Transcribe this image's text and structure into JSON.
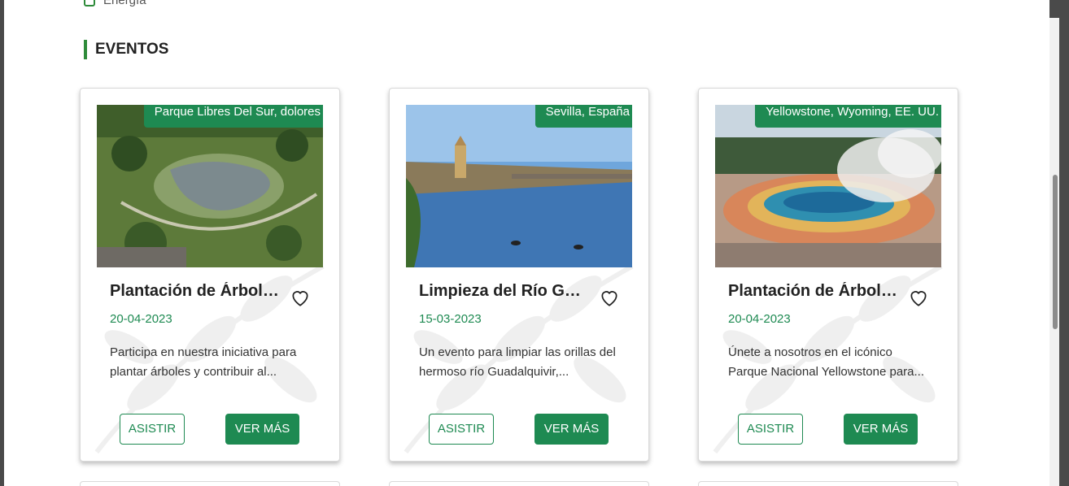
{
  "filters": {
    "energy_label": "Energía"
  },
  "section": {
    "title": "EVENTOS"
  },
  "events": [
    {
      "location": "Parque Libres Del Sur, dolores",
      "title": "Plantación de Árboles...",
      "date": "20-04-2023",
      "description": "Participa en nuestra iniciativa para plantar árboles y contribuir al...",
      "attend_label": "ASISTIR",
      "more_label": "VER MÁS"
    },
    {
      "location": "Sevilla, España",
      "title": "Limpieza del Río Guadalquivir...",
      "date": "15-03-2023",
      "description": "Un evento para limpiar las orillas del hermoso río Guadalquivir,...",
      "attend_label": "ASISTIR",
      "more_label": "VER MÁS"
    },
    {
      "location": "Yellowstone, Wyoming, EE. UU.",
      "title": "Plantación de Árboles...",
      "date": "20-04-2023",
      "description": "Únete a nosotros en el icónico Parque Nacional Yellowstone para...",
      "attend_label": "ASISTIR",
      "more_label": "VER MÁS"
    }
  ],
  "colors": {
    "accent": "#1e8a52",
    "section_bar": "#2e8b3a",
    "overlay": "#4a4a4a"
  }
}
